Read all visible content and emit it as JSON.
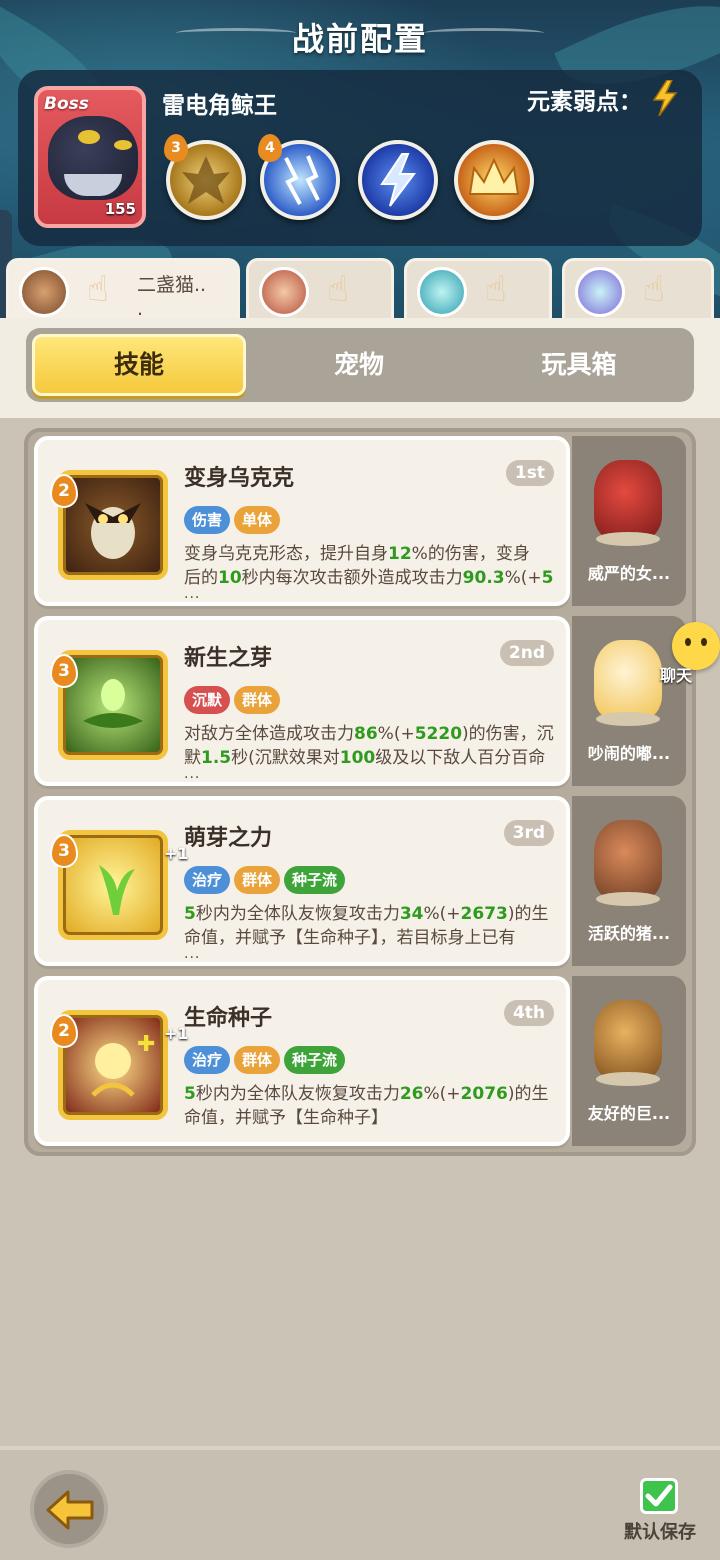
{
  "header": {
    "title": "战前配置"
  },
  "boss": {
    "tag": "Boss",
    "level": "155",
    "name": "雷电角鲸王",
    "weakness_label": "元素弱点：",
    "weakness_icon": "lightning-icon",
    "skills": [
      {
        "badge": "3",
        "icon": "golden-claw-icon",
        "color": "#c79a2a"
      },
      {
        "badge": "4",
        "icon": "blue-lightning-icon",
        "color": "#3a6fd8"
      },
      {
        "badge": "",
        "icon": "lightning-bolt-icon",
        "color": "#2f56c9"
      },
      {
        "badge": "",
        "icon": "golden-crown-icon",
        "color": "#e0931c"
      }
    ]
  },
  "players": [
    {
      "name": "二盏猫..",
      "extra": ".",
      "active": true
    },
    {
      "name": "",
      "active": false
    },
    {
      "name": "",
      "active": false
    },
    {
      "name": "",
      "active": false
    }
  ],
  "tabs": {
    "skills": "技能",
    "pets": "宠物",
    "toybox": "玩具箱"
  },
  "skill_cards": [
    {
      "level": "2",
      "name": "变身乌克克",
      "rank": "1st",
      "tags": [
        {
          "text": "伤害",
          "color": "#4d90d8"
        },
        {
          "text": "单体",
          "color": "#e9a33a"
        }
      ],
      "desc_line1": "变身乌克克形态，提升自身12%的伤害，变身",
      "desc_line2": "后的10秒内每次攻击额外造成攻击力90.3%(+5",
      "more": "...",
      "plus": "",
      "pet_name": "威严的女..."
    },
    {
      "level": "3",
      "name": "新生之芽",
      "rank": "2nd",
      "tags": [
        {
          "text": "沉默",
          "color": "#d6504f"
        },
        {
          "text": "群体",
          "color": "#e9a33a"
        }
      ],
      "desc_line1": "对敌方全体造成攻击力86%(+5220)的伤害，沉",
      "desc_line2": "默1.5秒(沉默效果对100级及以下敌人百分百命",
      "more": "...",
      "plus": "",
      "pet_name": "吵闹的嘟..."
    },
    {
      "level": "3",
      "name": "萌芽之力",
      "rank": "3rd",
      "tags": [
        {
          "text": "治疗",
          "color": "#4d90d8"
        },
        {
          "text": "群体",
          "color": "#e9a33a"
        },
        {
          "text": "种子流",
          "color": "#3ea43a"
        }
      ],
      "desc_line1": "5秒内为全体队友恢复攻击力34%(+2673)的生",
      "desc_line2": "命值，并赋予【生命种子】，若目标身上已有",
      "more": "...",
      "plus": "+1",
      "pet_name": "活跃的猪..."
    },
    {
      "level": "2",
      "name": "生命种子",
      "rank": "4th",
      "tags": [
        {
          "text": "治疗",
          "color": "#4d90d8"
        },
        {
          "text": "群体",
          "color": "#e9a33a"
        },
        {
          "text": "种子流",
          "color": "#3ea43a"
        }
      ],
      "desc_line1": "5秒内为全体队友恢复攻击力26%(+2076)的生",
      "desc_line2": "命值，并赋予【生命种子】",
      "more": "",
      "plus": "+1",
      "pet_name": "友好的巨..."
    }
  ],
  "chat": {
    "label": "聊天"
  },
  "footer": {
    "save_label": "默认保存"
  }
}
